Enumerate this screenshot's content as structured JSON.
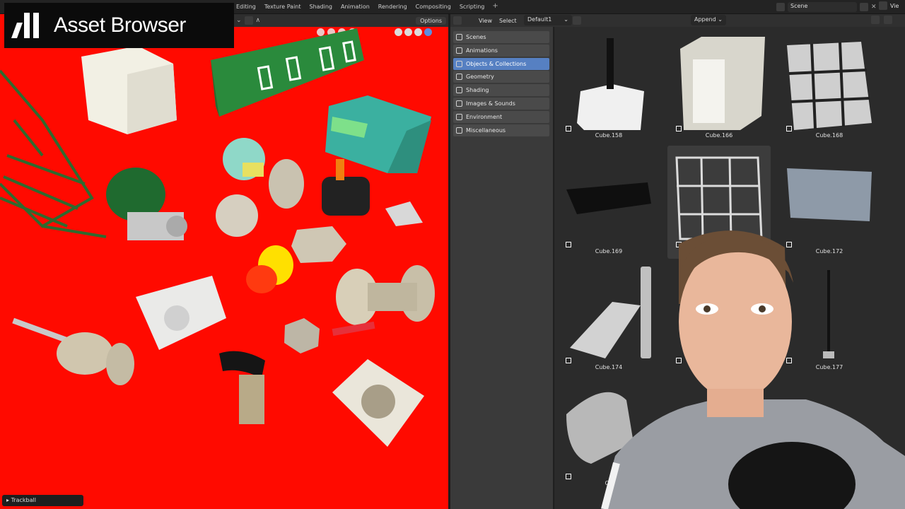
{
  "workspace_tabs": [
    "Editing",
    "Texture Paint",
    "Shading",
    "Animation",
    "Rendering",
    "Compositing",
    "Scripting"
  ],
  "workspace_add": "+",
  "scene": {
    "name": "Scene",
    "view_label": "Vie"
  },
  "logo": {
    "text": "Asset Browser"
  },
  "viewport": {
    "options_label": "Options",
    "status": "Trackball",
    "background": "#ff0a00"
  },
  "file_browser": {
    "menus": [
      "View",
      "Select"
    ],
    "library": "Default1",
    "import_mode": "Append",
    "categories": [
      {
        "label": "Scenes",
        "icon": "scene-icon"
      },
      {
        "label": "Animations",
        "icon": "action-icon"
      },
      {
        "label": "Objects & Collections",
        "icon": "object-icon",
        "active": true
      },
      {
        "label": "Geometry",
        "icon": "mesh-icon"
      },
      {
        "label": "Shading",
        "icon": "material-icon"
      },
      {
        "label": "Images & Sounds",
        "icon": "image-icon"
      },
      {
        "label": "Environment",
        "icon": "world-icon"
      },
      {
        "label": "Miscellaneous",
        "icon": "misc-icon"
      }
    ],
    "assets": [
      "Cube.158",
      "Cube.166",
      "Cube.168",
      "Cube.169",
      "",
      "Cube.172",
      "Cube.174",
      "",
      "Cube.177",
      "Cu"
    ]
  },
  "colors": {
    "accent": "#5680c2",
    "viewport_bg": "#ff0a00"
  }
}
